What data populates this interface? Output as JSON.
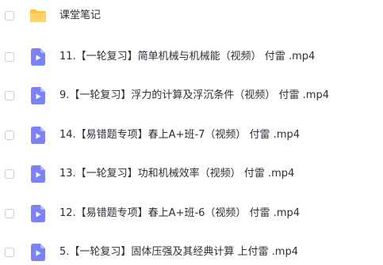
{
  "items": [
    {
      "type": "folder",
      "icon": "folder-icon",
      "name": "课堂笔记"
    },
    {
      "type": "video",
      "icon": "video-file-icon",
      "name": "11.【一轮复习】简单机械与机械能（视频） 付雷 .mp4"
    },
    {
      "type": "video",
      "icon": "video-file-icon",
      "name": "9.【一轮复习】浮力的计算及浮沉条件（视频） 付雷 .mp4"
    },
    {
      "type": "video",
      "icon": "video-file-icon",
      "name": "14.【易错题专项】春上A+班-7（视频） 付雷 .mp4"
    },
    {
      "type": "video",
      "icon": "video-file-icon",
      "name": "13.【一轮复习】功和机械效率（视频） 付雷 .mp4"
    },
    {
      "type": "video",
      "icon": "video-file-icon",
      "name": "12.【易错题专项】春上A+班-6（视频） 付雷 .mp4"
    },
    {
      "type": "video",
      "icon": "video-file-icon",
      "name": "5.【一轮复习】固体压强及其经典计算 上付雷 .mp4"
    }
  ],
  "colors": {
    "folder": "#ffc53d",
    "video": "#7b82f6"
  }
}
